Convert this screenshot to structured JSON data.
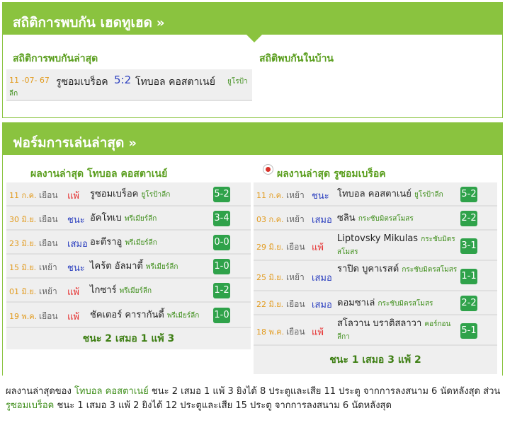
{
  "h2h": {
    "title": "สถิติการพบกัน เฮดทูเฮด",
    "chevron": "»",
    "latest_title": "สถิติการพบกันล่าสุด",
    "home_title": "สถิติพบกันในบ้าน",
    "match": {
      "date": "11 -07- 67",
      "home": "รูซอมเบร็อค",
      "score": "5:2",
      "away": "โทบอล คอสตาเนย์",
      "comp_a": "ยูโรป้า",
      "comp_b": "ลีก"
    }
  },
  "form": {
    "title": "ฟอร์มการเล่นล่าสุด",
    "chevron": "»",
    "left": {
      "title": "ผลงานล่าสุด โทบอล คอสตาเนย์",
      "rows": [
        {
          "date": "11 ก.ค.",
          "venue": "เยือน",
          "result": "แพ้",
          "type": "loss",
          "opponent": "รูซอมเบร็อค",
          "comp": "ยูโรป้าลีก",
          "score": "5-2"
        },
        {
          "date": "30 มิ.ย.",
          "venue": "เยือน",
          "result": "ชนะ",
          "type": "win",
          "opponent": "อัคโทเบ",
          "comp": "พรีเมียร์ลีก",
          "score": "3-4"
        },
        {
          "date": "23 มิ.ย.",
          "venue": "เยือน",
          "result": "เสมอ",
          "type": "draw",
          "opponent": "อะตีราอู",
          "comp": "พรีเมียร์ลีก",
          "score": "0-0"
        },
        {
          "date": "15 มิ.ย.",
          "venue": "เหย้า",
          "result": "ชนะ",
          "type": "win",
          "opponent": "ไคร้ต อัลมาตี้",
          "comp": "พรีเมียร์ลีก",
          "score": "1-0"
        },
        {
          "date": "01 มิ.ย.",
          "venue": "เหย้า",
          "result": "แพ้",
          "type": "loss",
          "opponent": "ไกซาร์",
          "comp": "พรีเมียร์ลีก",
          "score": "1-2"
        },
        {
          "date": "19 พ.ค.",
          "venue": "เยือน",
          "result": "แพ้",
          "type": "loss",
          "opponent": "ชัคเตอร์ คารากันดี้",
          "comp": "พรีเมียร์ลีก",
          "score": "1-0"
        }
      ],
      "summary": "ชนะ 2 เสมอ 1 แพ้ 3"
    },
    "right": {
      "title": "ผลงานล่าสุด รูซอมเบร็อค",
      "rows": [
        {
          "date": "11 ก.ค.",
          "venue": "เหย้า",
          "result": "ชนะ",
          "type": "win",
          "opponent": "โทบอล คอสตาเนย์",
          "comp": "ยูโรป้าลีก",
          "score": "5-2"
        },
        {
          "date": "03 ก.ค.",
          "venue": "เหย้า",
          "result": "เสมอ",
          "type": "draw",
          "opponent": "ซลิน",
          "comp": "กระชับมิตรสโมสร",
          "score": "2-2"
        },
        {
          "date": "29 มิ.ย.",
          "venue": "เยือน",
          "result": "แพ้",
          "type": "loss",
          "opponent": "Liptovsky Mikulas",
          "comp": "กระชับมิตรสโมสร",
          "score": "3-1"
        },
        {
          "date": "25 มิ.ย.",
          "venue": "เหย้า",
          "result": "เสมอ",
          "type": "draw",
          "opponent": "ราปิด บูคาเรสต์",
          "comp": "กระชับมิตรสโมสร",
          "score": "1-1"
        },
        {
          "date": "22 มิ.ย.",
          "venue": "เยือน",
          "result": "เสมอ",
          "type": "draw",
          "opponent": "ดอมซาเล่",
          "comp": "กระชับมิตรสโมสร",
          "score": "2-2"
        },
        {
          "date": "18 พ.ค.",
          "venue": "เยือน",
          "result": "แพ้",
          "type": "loss",
          "opponent": "สโลวาน บราติสลาวา",
          "comp": "คอร์กอน ลีกา",
          "score": "5-1"
        }
      ],
      "summary": "ชนะ 1 เสมอ 3 แพ้ 2"
    }
  },
  "footer": {
    "p1": "ผลงานล่าสุดของ ",
    "team1": "โทบอล คอสตาเนย์",
    "p2": " ชนะ 2 เสมอ 1 แพ้ 3 ยิงได้ 8 ประตูและเสีย 11 ประตู จากการลงสนาม 6 นัดหลังสุด ส่วน ",
    "team2": "รูซอมเบร็อค",
    "p3": " ชนะ 1 เสมอ 3 แพ้ 2 ยิงได้ 12 ประตูและเสีย 15 ประตู จากการลงสนาม 6 นัดหลังสุด"
  },
  "colors": {
    "accent": "#8ac33f",
    "score_box": "#2fa24a",
    "loss": "#e63333",
    "win_draw": "#2b3fbf",
    "date": "#e29b1e"
  }
}
